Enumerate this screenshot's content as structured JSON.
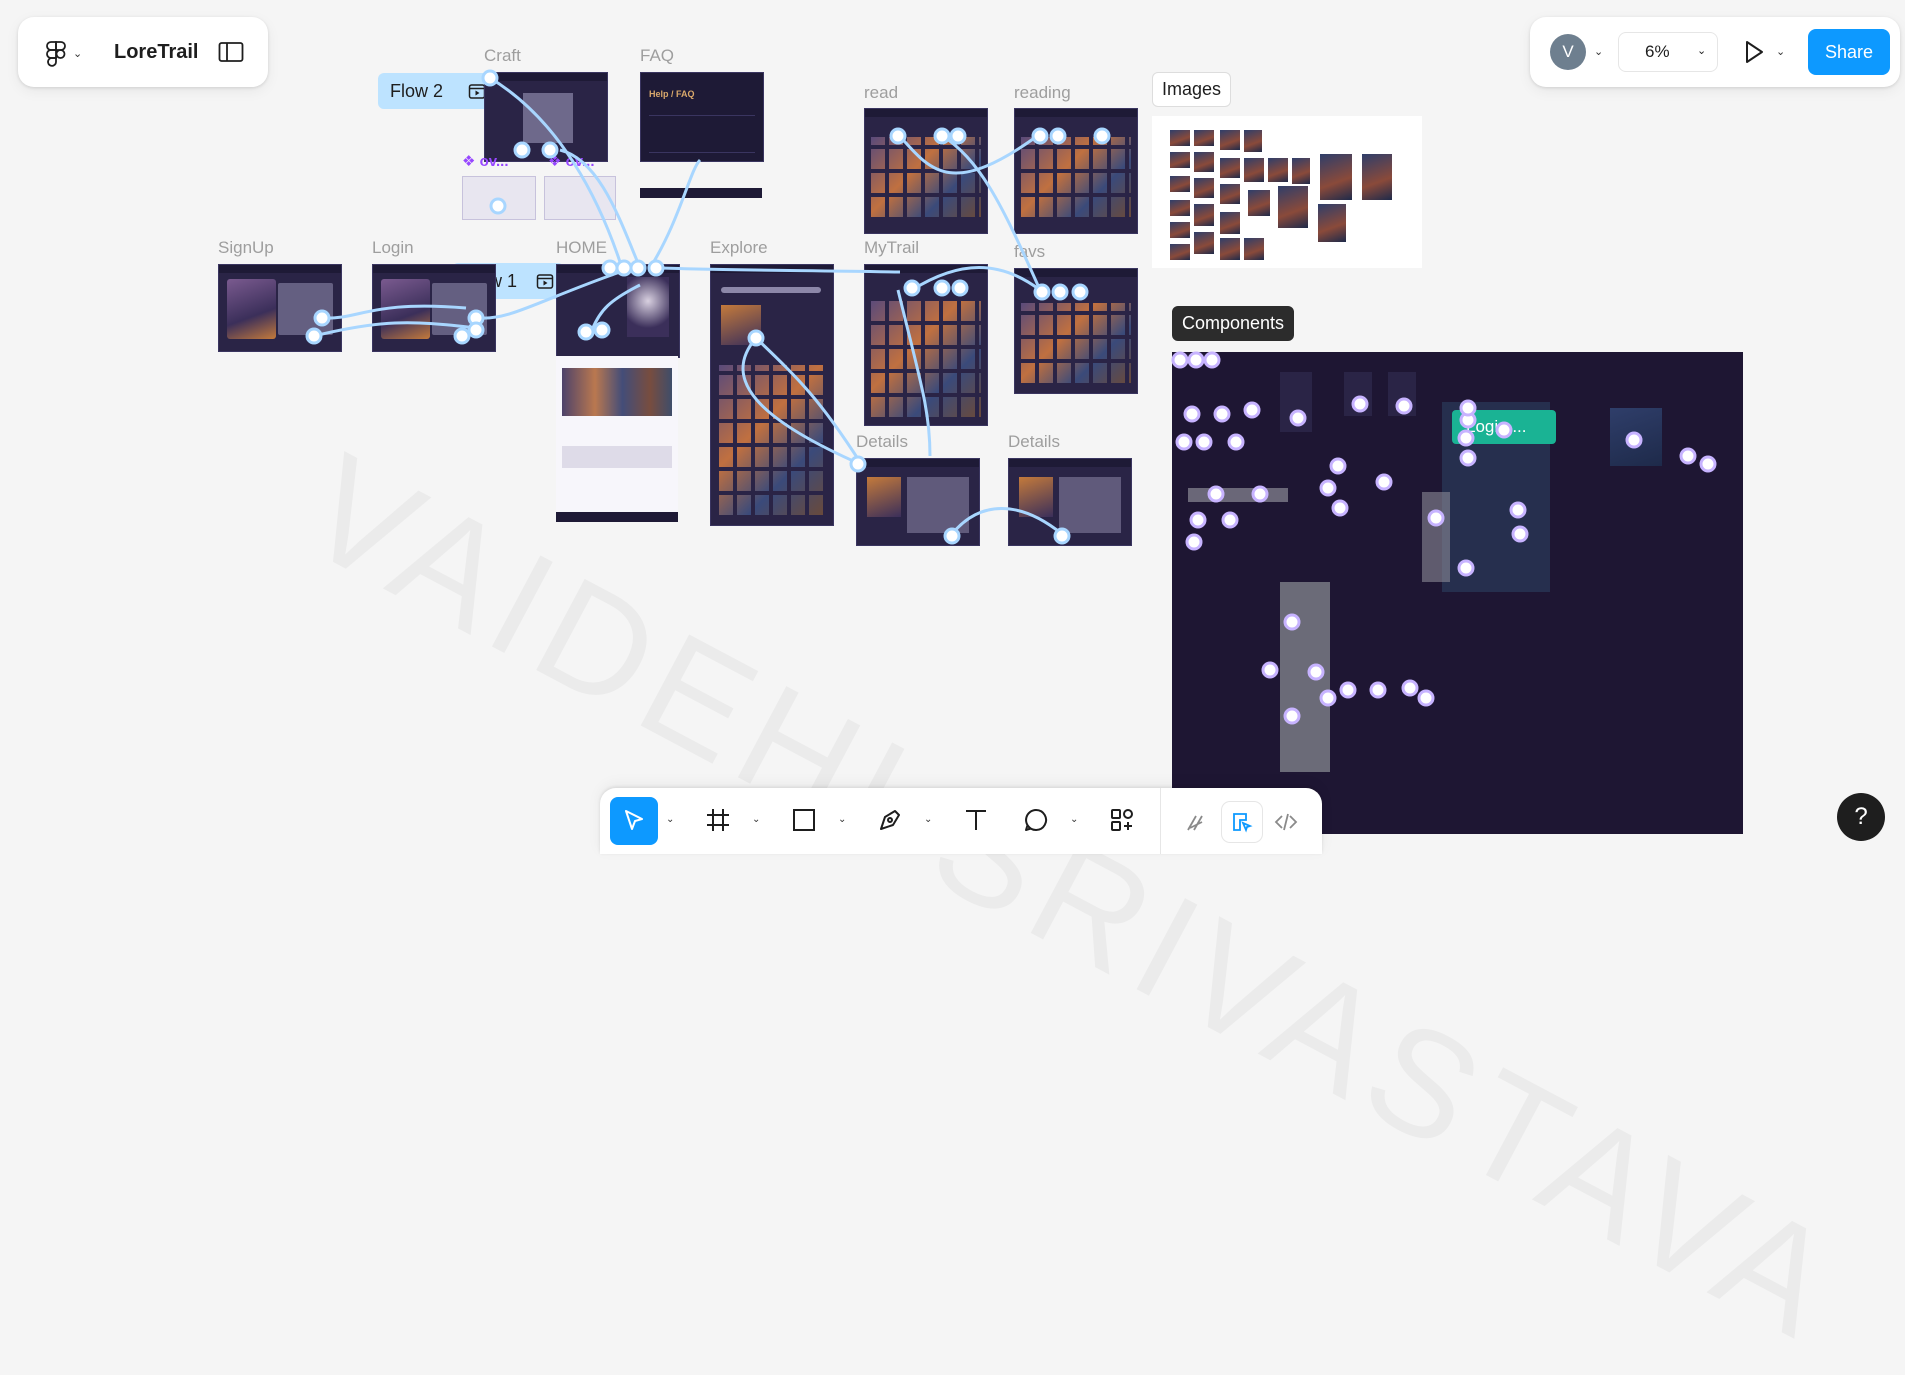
{
  "file": {
    "name": "LoreTrail"
  },
  "toolbar_right": {
    "avatar_initial": "V",
    "zoom": "6%",
    "share_label": "Share"
  },
  "canvas": {
    "flows": [
      "Flow 2",
      "Flow 1"
    ],
    "frame_labels": {
      "craft": "Craft",
      "faq": "FAQ",
      "read": "read",
      "reading": "reading",
      "signup": "SignUp",
      "login": "Login",
      "home": "HOME",
      "explore": "Explore",
      "mytrail": "MyTrail",
      "favs": "favs",
      "details1": "Details",
      "details2": "Details"
    },
    "ov_labels": [
      "ov...",
      "ov..."
    ],
    "sections": {
      "images": "Images",
      "components": "Components"
    },
    "component_chip": "Login ...",
    "faq_heading": "Help / FAQ",
    "watermark": "VAIDEHI SRIVASTAVA"
  },
  "bottom_tools": [
    {
      "name": "move-tool",
      "active": true
    },
    {
      "name": "frame-tool"
    },
    {
      "name": "shape-tool"
    },
    {
      "name": "pen-tool"
    },
    {
      "name": "text-tool"
    },
    {
      "name": "comment-tool"
    },
    {
      "name": "actions-tool"
    }
  ],
  "modes": [
    "draw-mode",
    "design-mode",
    "dev-mode"
  ],
  "help_label": "?",
  "colors": {
    "accent": "#0d99ff",
    "flow_chip": "#bde3ff",
    "component_bg": "#1e1633",
    "connector": "#a8d6ff"
  }
}
